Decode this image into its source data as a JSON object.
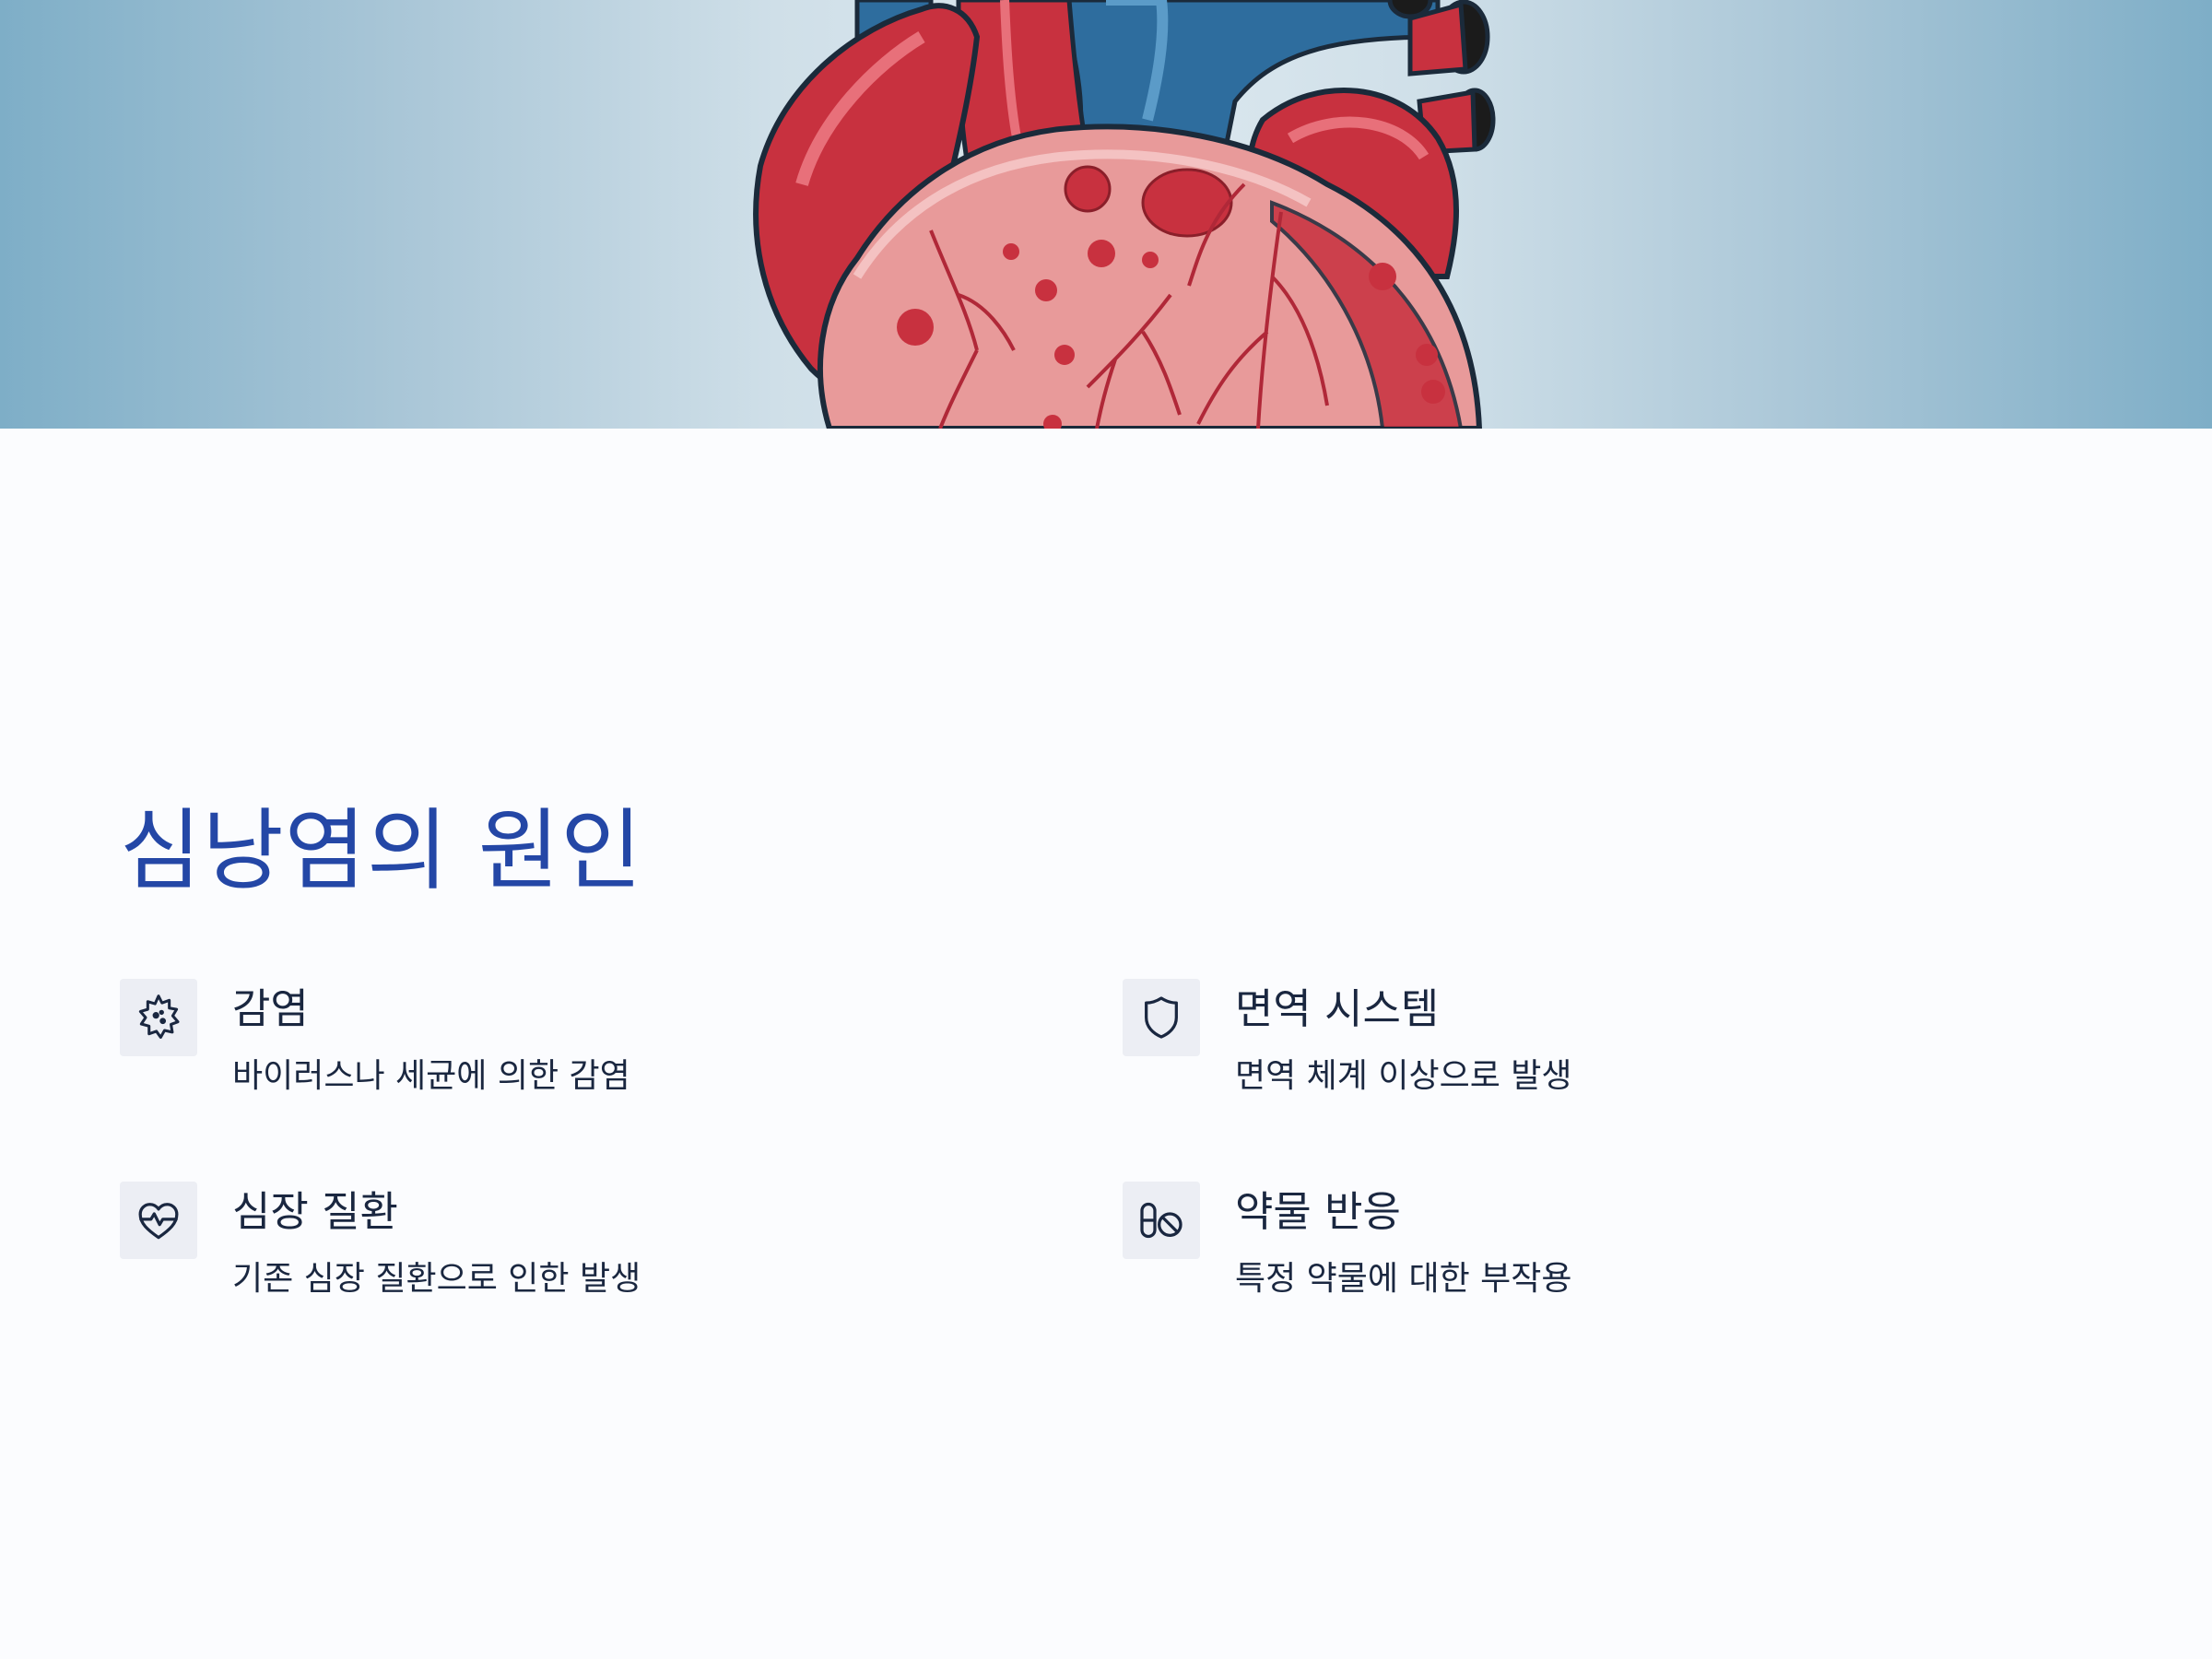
{
  "hero": {
    "image": "heart-illustration"
  },
  "title": "심낭염의 원인",
  "causes": [
    {
      "icon": "virus-icon",
      "title": "감염",
      "desc": "바이러스나 세균에 의한 감염"
    },
    {
      "icon": "shield-icon",
      "title": "면역 시스템",
      "desc": "면역 체계 이상으로 발생"
    },
    {
      "icon": "heart-pulse-icon",
      "title": "심장 질환",
      "desc": "기존 심장 질환으로 인한 발생"
    },
    {
      "icon": "pill-ban-icon",
      "title": "약물 반응",
      "desc": "특정 약물에 대한 부작용"
    }
  ],
  "colors": {
    "title": "#2447a6",
    "text": "#1a2740",
    "icon_bg": "#eceef4",
    "hero_edge": "#7eaec7",
    "hero_center": "#dde9f0",
    "heart_red": "#c8313f",
    "vessel_blue": "#2e6d9e"
  }
}
